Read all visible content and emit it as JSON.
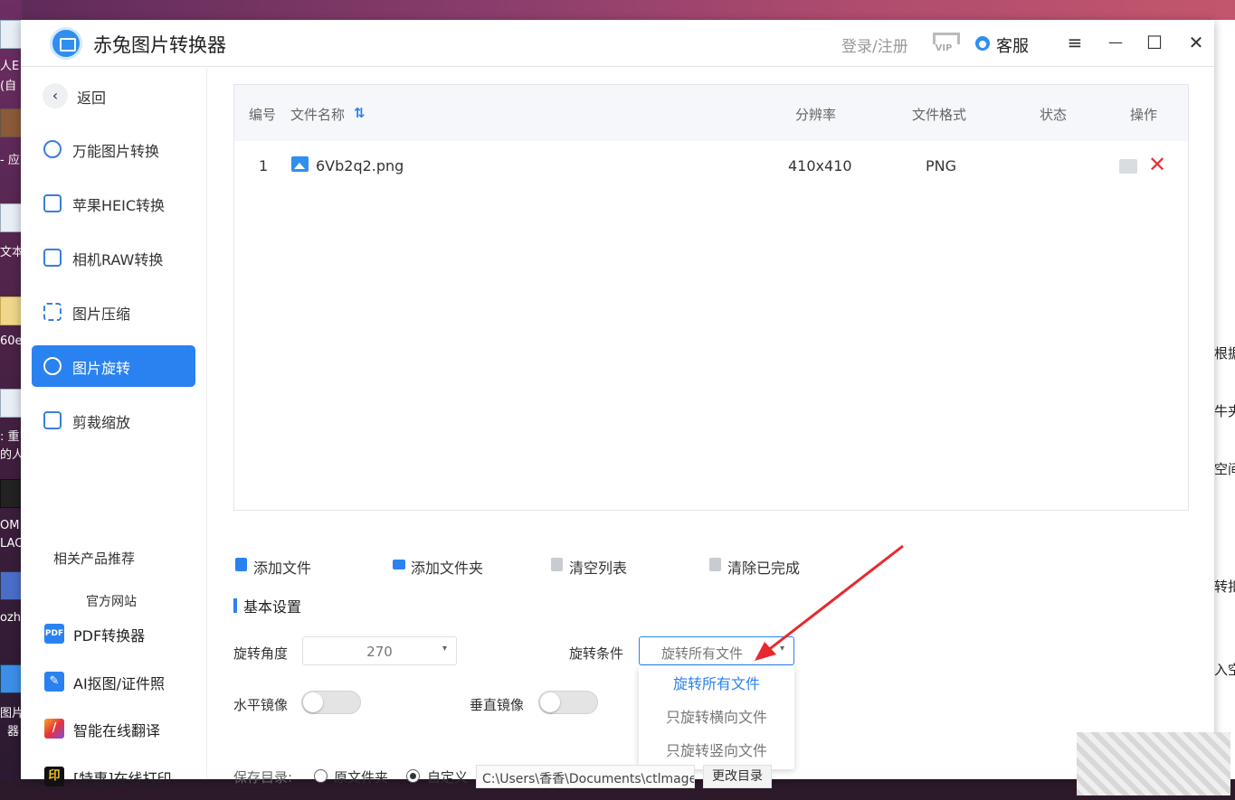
{
  "app": {
    "title": "赤兔图片转换器",
    "login": "登录/注册",
    "vip": "VIP",
    "service": "客服",
    "menu_icon": "≡",
    "min_icon": "—",
    "max_icon": "☐",
    "close_icon": "✕"
  },
  "sidebar": {
    "back": "返回",
    "back_icon": "‹",
    "items": [
      {
        "label": "万能图片转换"
      },
      {
        "label": "苹果HEIC转换"
      },
      {
        "label": "相机RAW转换"
      },
      {
        "label": "图片压缩"
      },
      {
        "label": "图片旋转"
      },
      {
        "label": "剪裁缩放"
      }
    ],
    "recommend_title": "相关产品推荐",
    "official_site": "官方网站",
    "products": [
      {
        "label": "PDF转换器",
        "icon": "PDF"
      },
      {
        "label": "AI抠图/证件照",
        "icon": "✎"
      },
      {
        "label": "智能在线翻译",
        "icon": "/"
      },
      {
        "label": "[特惠]在线打印",
        "icon": "印"
      }
    ]
  },
  "table": {
    "headers": {
      "index": "编号",
      "name": "文件名称",
      "sort_icon": "⇅",
      "resolution": "分辨率",
      "format": "文件格式",
      "status": "状态",
      "action": "操作"
    },
    "rows": [
      {
        "index": "1",
        "name": "6Vb2q2.png",
        "resolution": "410x410",
        "format": "PNG",
        "status": ""
      }
    ],
    "delete_icon": "✕"
  },
  "toolbar": {
    "add_file": "添加文件",
    "add_folder": "添加文件夹",
    "clear_list": "清空列表",
    "clear_done": "清除已完成"
  },
  "settings": {
    "section_title": "基本设置",
    "angle_label": "旋转角度",
    "angle_value": "270",
    "condition_label": "旋转条件",
    "condition_value": "旋转所有文件",
    "condition_options": [
      "旋转所有文件",
      "只旋转横向文件",
      "只旋转竖向文件"
    ],
    "hmirror_label": "水平镜像",
    "vmirror_label": "垂直镜像",
    "arrow_down": "▾"
  },
  "save": {
    "label": "保存目录:",
    "option_original": "原文件夹",
    "option_custom": "自定义",
    "path": "C:\\Users\\香香\\Documents\\ctlmage",
    "change_button": "更改目录"
  },
  "desktop": {
    "left_texts": [
      "人E",
      "(自",
      "- 应",
      "文本",
      "60e",
      ": 重",
      "的人",
      "OM",
      "LAC",
      "ozhi",
      "图片",
      "器"
    ],
    "right_texts": [
      "根据",
      "牛夹",
      "空间",
      "转扣",
      "入空"
    ]
  },
  "colors": {
    "accent": "#2a82f0",
    "danger": "#e8323a",
    "arrow": "#e8282e"
  }
}
